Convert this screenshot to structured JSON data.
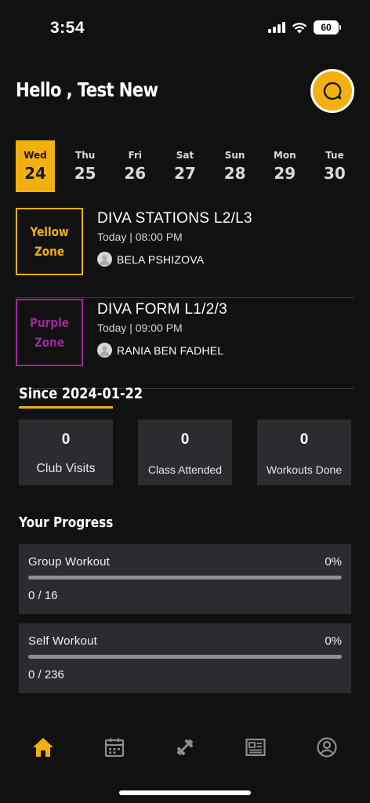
{
  "status_bar": {
    "time": "3:54",
    "battery": "60"
  },
  "header": {
    "greeting": "Hello , Test New"
  },
  "calendar": [
    {
      "day": "Wed",
      "date": "24",
      "selected": true
    },
    {
      "day": "Thu",
      "date": "25",
      "selected": false
    },
    {
      "day": "Fri",
      "date": "26",
      "selected": false
    },
    {
      "day": "Sat",
      "date": "27",
      "selected": false
    },
    {
      "day": "Sun",
      "date": "28",
      "selected": false
    },
    {
      "day": "Mon",
      "date": "29",
      "selected": false
    },
    {
      "day": "Tue",
      "date": "30",
      "selected": false
    }
  ],
  "classes": [
    {
      "zone_line1": "Yellow",
      "zone_line2": "Zone",
      "zone_color": "#f4b011",
      "title": "DIVA STATIONS L2/L3",
      "time": "Today | 08:00 PM",
      "trainer": "BELA PSHIZOVA"
    },
    {
      "zone_line1": "Purple",
      "zone_line2": "Zone",
      "zone_color": "#9b2a9f",
      "title": "DIVA FORM L1/2/3",
      "time": "Today | 09:00 PM",
      "trainer": "RANIA BEN FADHEL"
    }
  ],
  "since": {
    "title": "Since 2024-01-22"
  },
  "stats": [
    {
      "value": "0",
      "label": "Club Visits"
    },
    {
      "value": "0",
      "label": "Class Attended"
    },
    {
      "value": "0",
      "label": "Workouts Done"
    }
  ],
  "progress": {
    "title": "Your Progress",
    "items": [
      {
        "name": "Group Workout",
        "percent": "0%",
        "fraction": 0,
        "count": "0 / 16"
      },
      {
        "name": "Self Workout",
        "percent": "0%",
        "fraction": 0,
        "count": "0 / 236"
      }
    ]
  },
  "nav": {
    "items": [
      {
        "icon": "home-icon",
        "active": true
      },
      {
        "icon": "calendar-icon",
        "active": false
      },
      {
        "icon": "dumbbell-icon",
        "active": false
      },
      {
        "icon": "news-icon",
        "active": false
      },
      {
        "icon": "profile-icon",
        "active": false
      }
    ]
  },
  "colors": {
    "accent": "#f4b011",
    "background": "#111111",
    "card": "#2a2c30"
  }
}
